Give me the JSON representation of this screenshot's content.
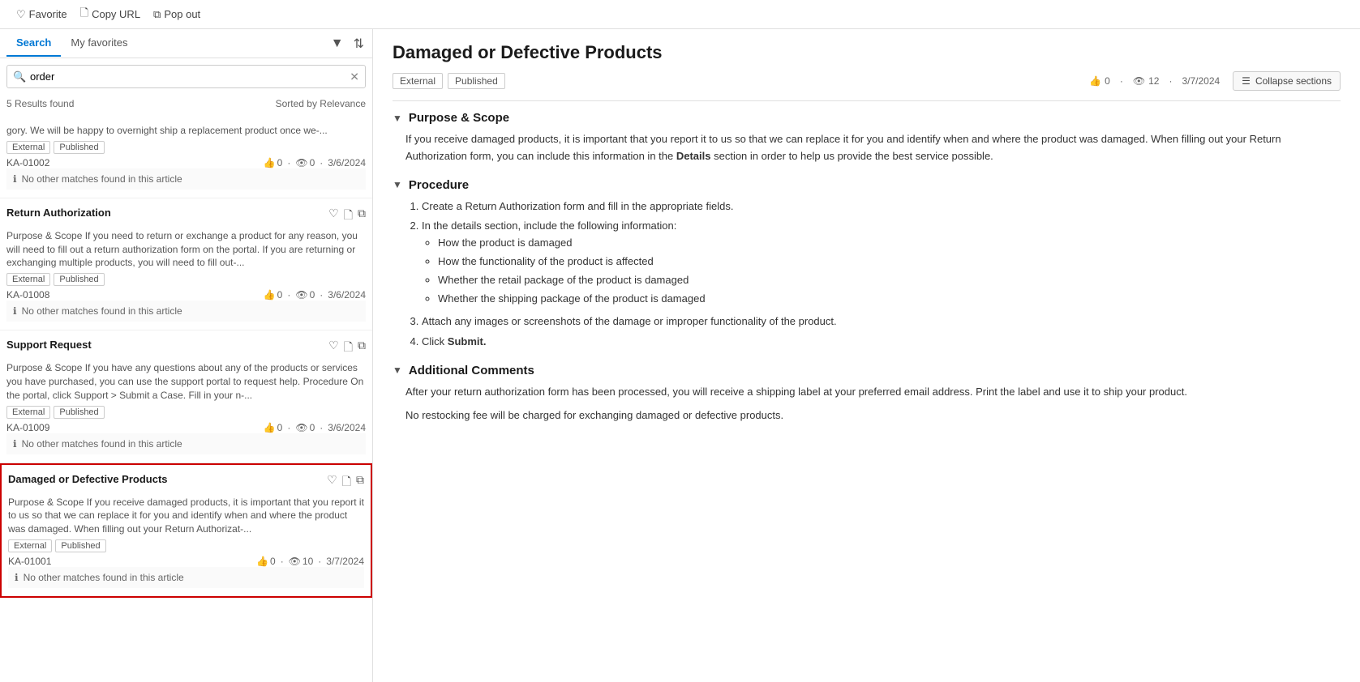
{
  "topBar": {
    "favorite_label": "Favorite",
    "copy_label": "Copy URL",
    "popout_label": "Pop out"
  },
  "leftPanel": {
    "tabs": [
      {
        "id": "search",
        "label": "Search",
        "active": true
      },
      {
        "id": "favorites",
        "label": "My favorites",
        "active": false
      }
    ],
    "search": {
      "value": "order",
      "placeholder": "order",
      "results_count": "5 Results found",
      "sorted_by": "Sorted by Relevance"
    },
    "results": [
      {
        "id": "result-1",
        "title": null,
        "snippet": "gory. We will be happy to overnight ship a replacement product once we-...",
        "tags": [
          "External",
          "Published"
        ],
        "ka_id": "KA-01002",
        "likes": "0",
        "views": "0",
        "date": "3/6/2024",
        "no_match": "No other matches found in this article",
        "selected": false
      },
      {
        "id": "result-2",
        "title": "Return Authorization",
        "snippet": "Purpose & Scope If you need to return or exchange a product for any reason, you will need to fill out a return authorization form on the portal. If you are returning or exchanging multiple products, you will need to fill out-...",
        "tags": [
          "External",
          "Published"
        ],
        "ka_id": "KA-01008",
        "likes": "0",
        "views": "0",
        "date": "3/6/2024",
        "no_match": "No other matches found in this article",
        "selected": false
      },
      {
        "id": "result-3",
        "title": "Support Request",
        "snippet": "Purpose & Scope If you have any questions about any of the products or services you have purchased, you can use the support portal to request help. Procedure On the portal, click Support > Submit a Case. Fill in your n-...",
        "tags": [
          "External",
          "Published"
        ],
        "ka_id": "KA-01009",
        "likes": "0",
        "views": "0",
        "date": "3/6/2024",
        "no_match": "No other matches found in this article",
        "selected": false
      },
      {
        "id": "result-4",
        "title": "Damaged or Defective Products",
        "snippet": "Purpose & Scope If you receive damaged products, it is important that you report it to us so that we can replace it for you and identify when and where the product was damaged. When filling out your Return Authorizat-...",
        "tags": [
          "External",
          "Published"
        ],
        "ka_id": "KA-01001",
        "likes": "0",
        "views": "10",
        "date": "3/7/2024",
        "no_match": "No other matches found in this article",
        "selected": true
      }
    ]
  },
  "rightPanel": {
    "title": "Damaged or Defective Products",
    "tags": [
      "External",
      "Published"
    ],
    "likes": "0",
    "views": "12",
    "date": "3/7/2024",
    "collapse_btn": "Collapse sections",
    "sections": [
      {
        "id": "purpose",
        "heading": "Purpose & Scope",
        "expanded": true,
        "content_type": "paragraph",
        "content": "If you receive damaged products, it is important that you report it to us so that we can replace it for you and identify when and where the product was damaged. When filling out your Return Authorization form, you can include this information in the Details section in order to help us provide the best service possible."
      },
      {
        "id": "procedure",
        "heading": "Procedure",
        "expanded": true,
        "content_type": "list",
        "steps": [
          {
            "text": "Create a Return Authorization form and fill in the appropriate fields.",
            "sub_items": []
          },
          {
            "text": "In the details section, include the following information:",
            "sub_items": [
              "How the product is damaged",
              "How the functionality of the product is affected",
              "Whether the retail package of the product is damaged",
              "Whether the shipping package of the product is damaged"
            ]
          },
          {
            "text": "Attach any images or screenshots of the damage or improper functionality of the product.",
            "sub_items": []
          },
          {
            "text": "Click Submit.",
            "sub_items": [],
            "bold_word": "Submit"
          }
        ]
      },
      {
        "id": "additional",
        "heading": "Additional Comments",
        "expanded": true,
        "content_type": "paragraphs",
        "paragraphs": [
          "After your return authorization form has been processed, you will receive a shipping label at your preferred email address. Print the label and use it to ship your product.",
          "No restocking fee will be charged for exchanging damaged or defective products."
        ]
      }
    ]
  }
}
